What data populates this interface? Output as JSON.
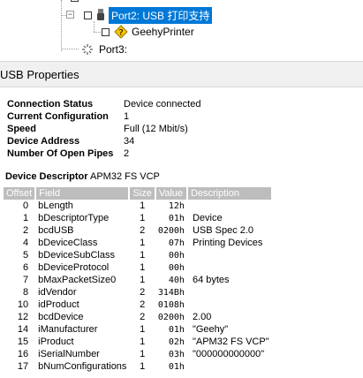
{
  "tree": {
    "port2_label": "Port2: USB 打印支持",
    "device_label": "GeehyPrinter",
    "port3_label": "Port3:"
  },
  "header": {
    "title": "USB Properties"
  },
  "properties": [
    {
      "label": "Connection Status",
      "value": "Device connected"
    },
    {
      "label": "Current Configuration",
      "value": "1"
    },
    {
      "label": "Speed",
      "value": "Full (12 Mbit/s)"
    },
    {
      "label": "Device Address",
      "value": "34"
    },
    {
      "label": "Number Of Open Pipes",
      "value": "2"
    }
  ],
  "descriptor": {
    "title_label": "Device Descriptor",
    "title_value": "APM32 FS VCP",
    "columns": [
      "Offset",
      "Field",
      "Size",
      "Value",
      "Description"
    ],
    "rows": [
      {
        "offset": "0",
        "field": "bLength",
        "size": "1",
        "value": "12h",
        "desc": ""
      },
      {
        "offset": "1",
        "field": "bDescriptorType",
        "size": "1",
        "value": "01h",
        "desc": "Device"
      },
      {
        "offset": "2",
        "field": "bcdUSB",
        "size": "2",
        "value": "0200h",
        "desc": "USB Spec 2.0"
      },
      {
        "offset": "4",
        "field": "bDeviceClass",
        "size": "1",
        "value": "07h",
        "desc": "Printing Devices"
      },
      {
        "offset": "5",
        "field": "bDeviceSubClass",
        "size": "1",
        "value": "00h",
        "desc": ""
      },
      {
        "offset": "6",
        "field": "bDeviceProtocol",
        "size": "1",
        "value": "00h",
        "desc": ""
      },
      {
        "offset": "7",
        "field": "bMaxPacketSize0",
        "size": "1",
        "value": "40h",
        "desc": "64 bytes"
      },
      {
        "offset": "8",
        "field": "idVendor",
        "size": "2",
        "value": "314Bh",
        "desc": ""
      },
      {
        "offset": "10",
        "field": "idProduct",
        "size": "2",
        "value": "0108h",
        "desc": ""
      },
      {
        "offset": "12",
        "field": "bcdDevice",
        "size": "2",
        "value": "0200h",
        "desc": "2.00"
      },
      {
        "offset": "14",
        "field": "iManufacturer",
        "size": "1",
        "value": "01h",
        "desc": "\"Geehy\""
      },
      {
        "offset": "15",
        "field": "iProduct",
        "size": "1",
        "value": "02h",
        "desc": "\"APM32 FS VCP\""
      },
      {
        "offset": "16",
        "field": "iSerialNumber",
        "size": "1",
        "value": "03h",
        "desc": "\"000000000000\""
      },
      {
        "offset": "17",
        "field": "bNumConfigurations",
        "size": "1",
        "value": "01h",
        "desc": ""
      }
    ]
  }
}
